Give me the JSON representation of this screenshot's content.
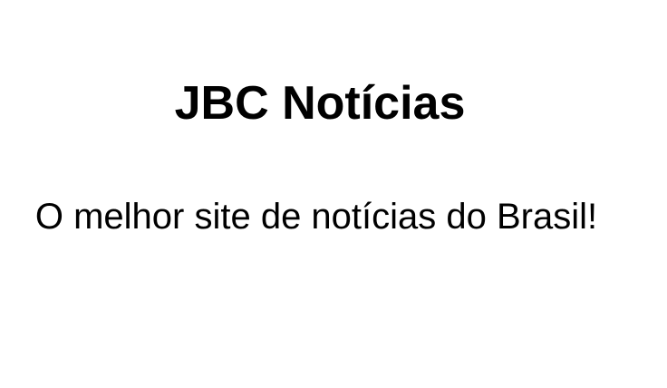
{
  "header": {
    "title": "JBC Notícias"
  },
  "main": {
    "tagline": "O melhor site de notícias do Brasil!"
  },
  "colors": {
    "background": "#ffffff",
    "text": "#000000"
  }
}
